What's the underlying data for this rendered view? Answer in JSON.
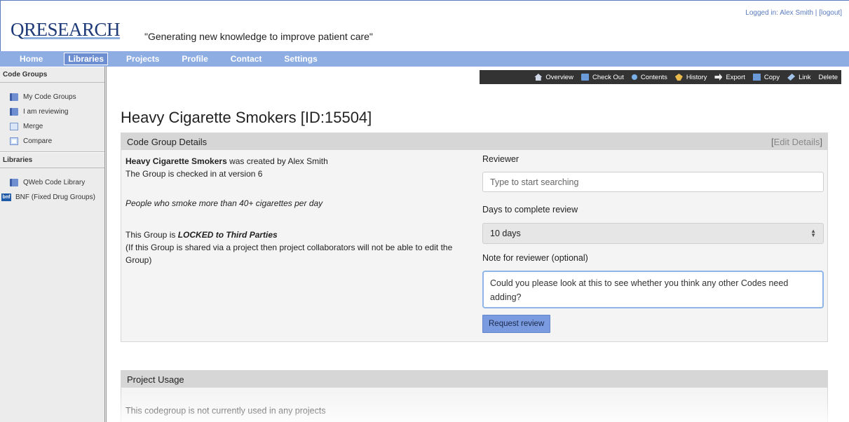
{
  "header": {
    "logo_q": "Q",
    "logo_rest": "RESEARCH",
    "tagline": "\"Generating new knowledge to improve patient care\"",
    "login_prefix": "Logged in: Alex Smith | ",
    "logout_label": "[logout]"
  },
  "nav": {
    "items": [
      "Home",
      "Libraries",
      "Projects",
      "Profile",
      "Contact",
      "Settings"
    ],
    "active": "Libraries"
  },
  "sidebar": {
    "code_groups_heading": "Code Groups",
    "code_groups": [
      "My Code Groups",
      "I am reviewing",
      "Merge",
      "Compare"
    ],
    "libraries_heading": "Libraries",
    "libraries": [
      "QWeb Code Library",
      "BNF (Fixed Drug Groups)"
    ],
    "bnf_icon_text": "bnf"
  },
  "toolbar": {
    "items": [
      "Overview",
      "Check Out",
      "Contents",
      "History",
      "Export",
      "Copy",
      "Link",
      "Delete"
    ]
  },
  "page": {
    "title": "Heavy Cigarette Smokers [ID:15504]"
  },
  "details": {
    "heading": "Code Group Details",
    "edit_label": "Edit Details",
    "group_name": "Heavy Cigarette Smokers",
    "created_suffix": " was created by Alex Smith",
    "version_line": "The Group is checked in at version 6",
    "description": "People who smoke more than 40+ cigarettes per day",
    "lock_prefix": "This Group is ",
    "lock_status": "LOCKED to Third Parties",
    "lock_note": "(If this Group is shared via a project then project collaborators will not be able to edit the Group)"
  },
  "review": {
    "reviewer_label": "Reviewer",
    "reviewer_placeholder": "Type to start searching",
    "days_label": "Days to complete review",
    "days_value": "10 days",
    "note_label": "Note for reviewer (optional)",
    "note_value": "Could you please look at this to see whether you think any other Codes need adding?",
    "request_button": "Request review"
  },
  "usage": {
    "heading": "Project Usage",
    "text": "This codegroup is not currently used in any projects"
  },
  "colors": {
    "nav_bg": "#8eaee3",
    "toolbar_bg": "#333333",
    "panel_head_bg": "#d6d6d6",
    "button_bg": "#7a9be0",
    "logo": "#1e3a78"
  }
}
